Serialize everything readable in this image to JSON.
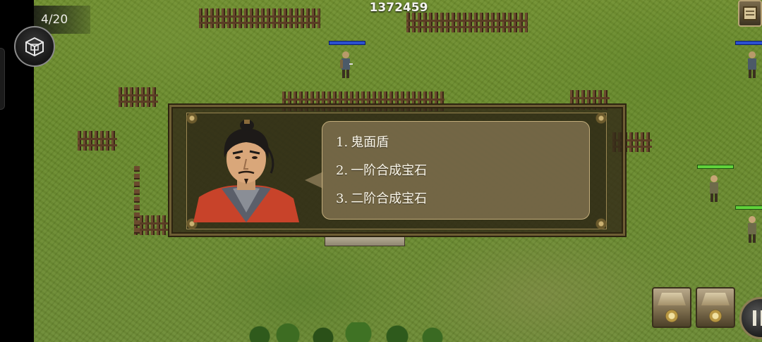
{
  "hud": {
    "wave_counter": "4/20",
    "score": "1372459",
    "menu_icon": "cube-menu-icon",
    "top_right_icon": "scroll-icon",
    "pause_icon": "pause-icon",
    "chest_icon": "treasure-chest-icon"
  },
  "dialog": {
    "portrait": "general-portrait",
    "options": [
      {
        "num": "1.",
        "label": "鬼面盾"
      },
      {
        "num": "2.",
        "label": "一阶合成宝石"
      },
      {
        "num": "3.",
        "label": "二阶合成宝石"
      }
    ]
  },
  "colors": {
    "grass": "#6b8a33",
    "dialog_bg": "#342c18",
    "bubble": "#847452",
    "enemy_hp": "#2a4fd0",
    "ally_hp": "#5fd23a"
  }
}
